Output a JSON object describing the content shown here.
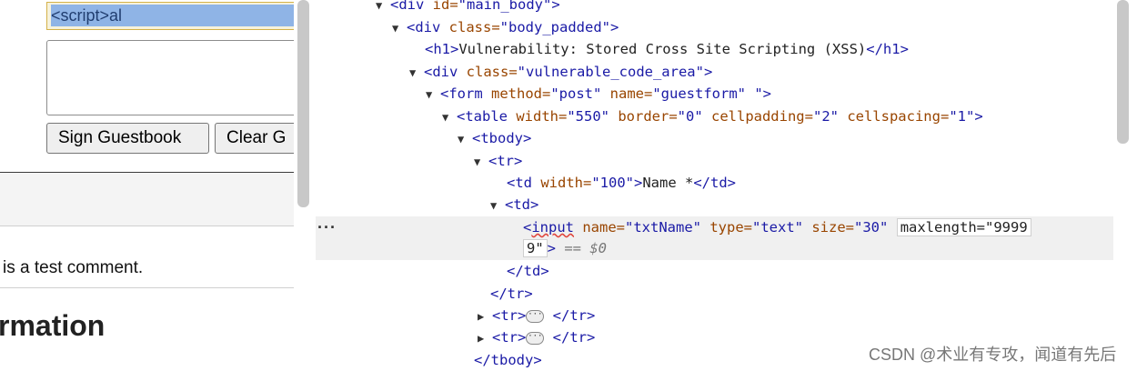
{
  "page": {
    "name_input_value": "<script>al",
    "sign_button": "Sign Guestbook",
    "clear_button": "Clear G",
    "comment_text": "is a test comment.",
    "info_heading": "rmation"
  },
  "devtools": {
    "lines": {
      "l0": {
        "tag_open": "<div ",
        "attr": "id=",
        "val": "\"main_body\"",
        "tag_close": ">"
      },
      "l1": {
        "tag_open": "<div ",
        "attr": "class=",
        "val": "\"body_padded\"",
        "tag_close": ">"
      },
      "l2": {
        "tag_open": "<h1>",
        "text": "Vulnerability: Stored Cross Site Scripting (XSS)",
        "tag_close": "</h1>"
      },
      "l3": {
        "tag_open": "<div ",
        "attr": "class=",
        "val": "\"vulnerable_code_area\"",
        "tag_close": ">"
      },
      "l4": {
        "tag_open": "<form ",
        "a1": "method=",
        "v1": "\"post\"",
        "a2": " name=",
        "v2": "\"guestform\"",
        "v3": " \"",
        "tag_close": ">"
      },
      "l5": {
        "tag_open": "<table ",
        "a1": "width=",
        "v1": "\"550\"",
        "a2": " border=",
        "v2": "\"0\"",
        "a3": " cellpadding=",
        "v3": "\"2\"",
        "a4": " cellspacing=",
        "v4": "\"1\"",
        "tag_close": ">"
      },
      "l6": {
        "tag_open": "<tbody>"
      },
      "l7": {
        "tag_open": "<tr>"
      },
      "l8": {
        "tag_open": "<td ",
        "attr": "width=",
        "val": "\"100\"",
        "tag_close": ">",
        "text": "Name *",
        "tag_end": "</td>"
      },
      "l9": {
        "tag_open": "<td>"
      },
      "l10": {
        "tag_open": "<",
        "tag_name": "input",
        "a1": " name=",
        "v1": "\"txtName\"",
        "a2": " type=",
        "v2": "\"text\"",
        "a3": " size=",
        "v3": "\"30\"",
        "boxed_attr": "maxlength=\"9999"
      },
      "l10b": {
        "cont": "9\"",
        "tag_close": ">",
        "eq": " == ",
        "ref": "$0"
      },
      "l11": {
        "tag_close": "</td>"
      },
      "l12": {
        "tag_close": "</tr>"
      },
      "l13": {
        "tag_open": "<tr>",
        "pill": "···",
        "tag_close": "</tr>"
      },
      "l14": {
        "tag_open": "<tr>",
        "pill": "···",
        "tag_close": "</tr>"
      },
      "l15": {
        "tag_close": "</tbody>"
      }
    },
    "row_menu": "···",
    "watermark": "CSDN @术业有专攻，闻道有先后"
  },
  "colors": {
    "tag": "#1a1aa6",
    "attr": "#994500",
    "selected_row": "#f0f0f0",
    "input_highlight": "#8fb4e6"
  }
}
